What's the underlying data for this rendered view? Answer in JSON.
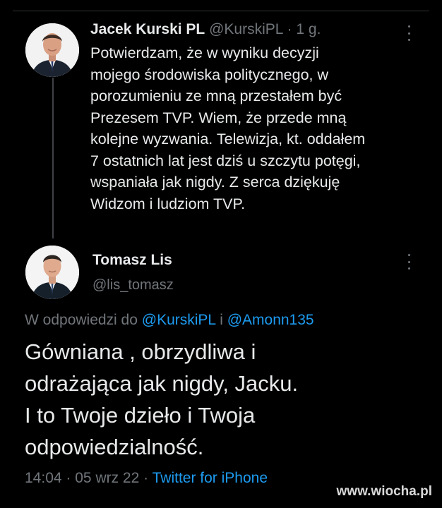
{
  "tweet": {
    "author_name": "Jacek Kurski PL",
    "author_handle": "@KurskiPL",
    "separator": "·",
    "time": "1 g.",
    "text_lines": [
      "Potwierdzam, że w wyniku decyzji",
      "mojego środowiska politycznego, w",
      "porozumieniu ze mną przestałem być",
      "Prezesem TVP. Wiem, że przede mną",
      "kolejne wyzwania. Telewizja, kt. oddałem",
      "7 ostatnich lat jest dziś u szczytu potęgi,",
      "wspaniała jak nigdy. Z serca dziękuję",
      "Widzom i ludziom TVP."
    ]
  },
  "reply": {
    "author_name": "Tomasz Lis",
    "author_handle": "@lis_tomasz",
    "reply_prefix": "W odpowiedzi do",
    "mention_1": "@KurskiPL",
    "conjunction": "i",
    "mention_2": "@Amonn135",
    "text_lines": [
      "Gówniana , obrzydliwa i",
      "odrażająca jak nigdy, Jacku.",
      "I to Twoje dzieło i Twoja",
      "odpowiedzialność."
    ],
    "time": "14:04",
    "date": "05 wrz 22",
    "separator": "·",
    "source": "Twitter for iPhone"
  },
  "watermark": "www.wiocha.pl",
  "icons": {
    "more": "more-vertical-icon"
  },
  "colors": {
    "background": "#000000",
    "text": "#e7e9ea",
    "muted": "#71767b",
    "link": "#1d9bf0"
  }
}
